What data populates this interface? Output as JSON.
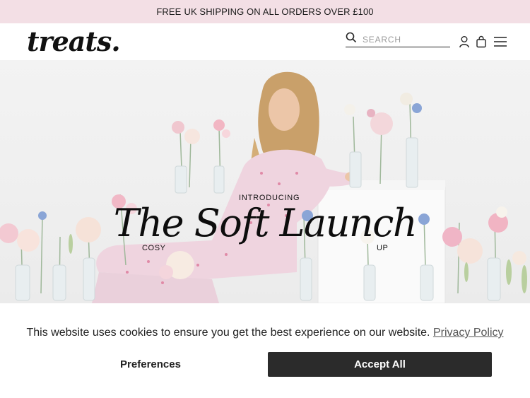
{
  "announcement": {
    "free": "FREE",
    "rest": "UK SHIPPING ON ALL ORDERS OVER £100"
  },
  "header": {
    "logo": "treats.",
    "search_placeholder": "SEARCH",
    "icons": [
      "search-icon",
      "account-icon",
      "bag-icon",
      "menu-icon"
    ]
  },
  "hero": {
    "intro": "INTRODUCING",
    "headline": "The Soft Launch",
    "tag_left": "COSY",
    "tag_right": "UP"
  },
  "cookie_banner": {
    "message": "This website uses cookies to ensure you get the best experience on our website.",
    "policy_link": "Privacy Policy",
    "preferences_label": "Preferences",
    "accept_label": "Accept All"
  },
  "colors": {
    "announcement_bg": "#f3dfe5",
    "accept_bg": "#2b2b2b",
    "pajama_pink": "#efd4df"
  }
}
